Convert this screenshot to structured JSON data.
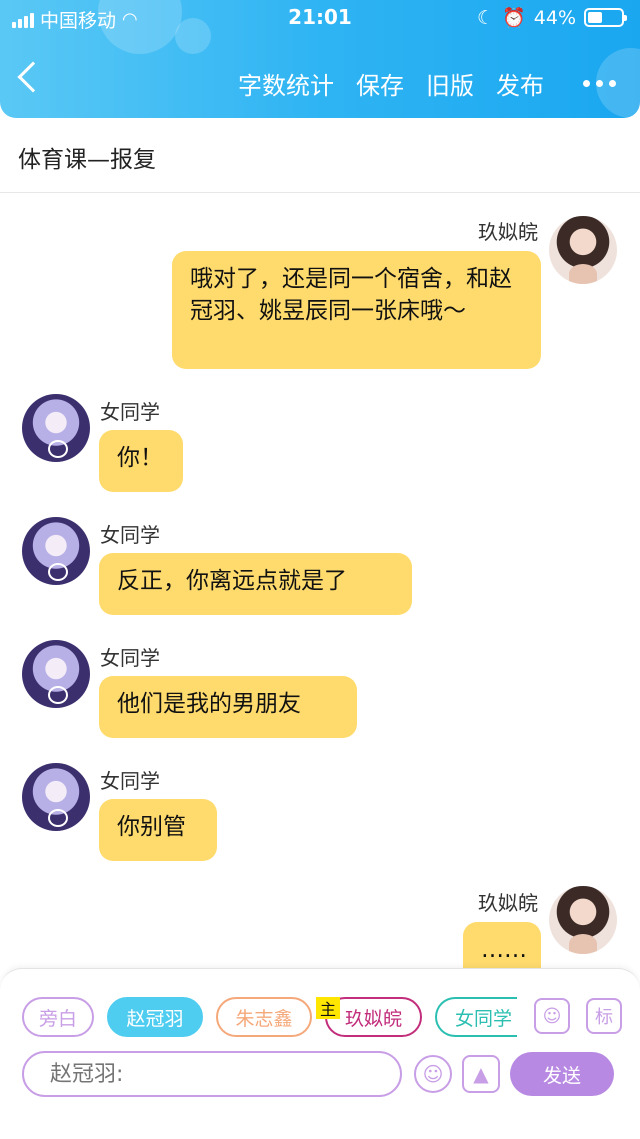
{
  "status_bar": {
    "carrier": "中国移动",
    "time": "21:01",
    "battery_percent": "44%",
    "battery_level": 0.44
  },
  "nav": {
    "back_icon": "chevron-left-icon",
    "actions": [
      "字数统计",
      "保存",
      "旧版",
      "发布"
    ],
    "more_icon": "more-dots-icon"
  },
  "story_title": "体育课—报复",
  "messages": [
    {
      "side": "right",
      "name": "玖姒皖",
      "text": "哦对了，还是同一个宿舍，和赵冠羽、姚昱辰同一张床哦～"
    },
    {
      "side": "left",
      "name": "女同学",
      "text": "你！"
    },
    {
      "side": "left",
      "name": "女同学",
      "text": "反正，你离远点就是了"
    },
    {
      "side": "left",
      "name": "女同学",
      "text": "他们是我的男朋友"
    },
    {
      "side": "left",
      "name": "女同学",
      "text": "你别管"
    },
    {
      "side": "right",
      "name": "玖姒皖",
      "text": "……"
    }
  ],
  "composer": {
    "roles": [
      "旁白",
      "赵冠羽",
      "朱志鑫",
      "玖姒皖",
      "女同学"
    ],
    "host_badge": "主",
    "biao_label": "标",
    "input_placeholder": "赵冠羽:",
    "send_label": "发送"
  },
  "colors": {
    "header": "#2fb4f3",
    "bubble": "#ffdb6e",
    "accent": "#b889e3"
  }
}
